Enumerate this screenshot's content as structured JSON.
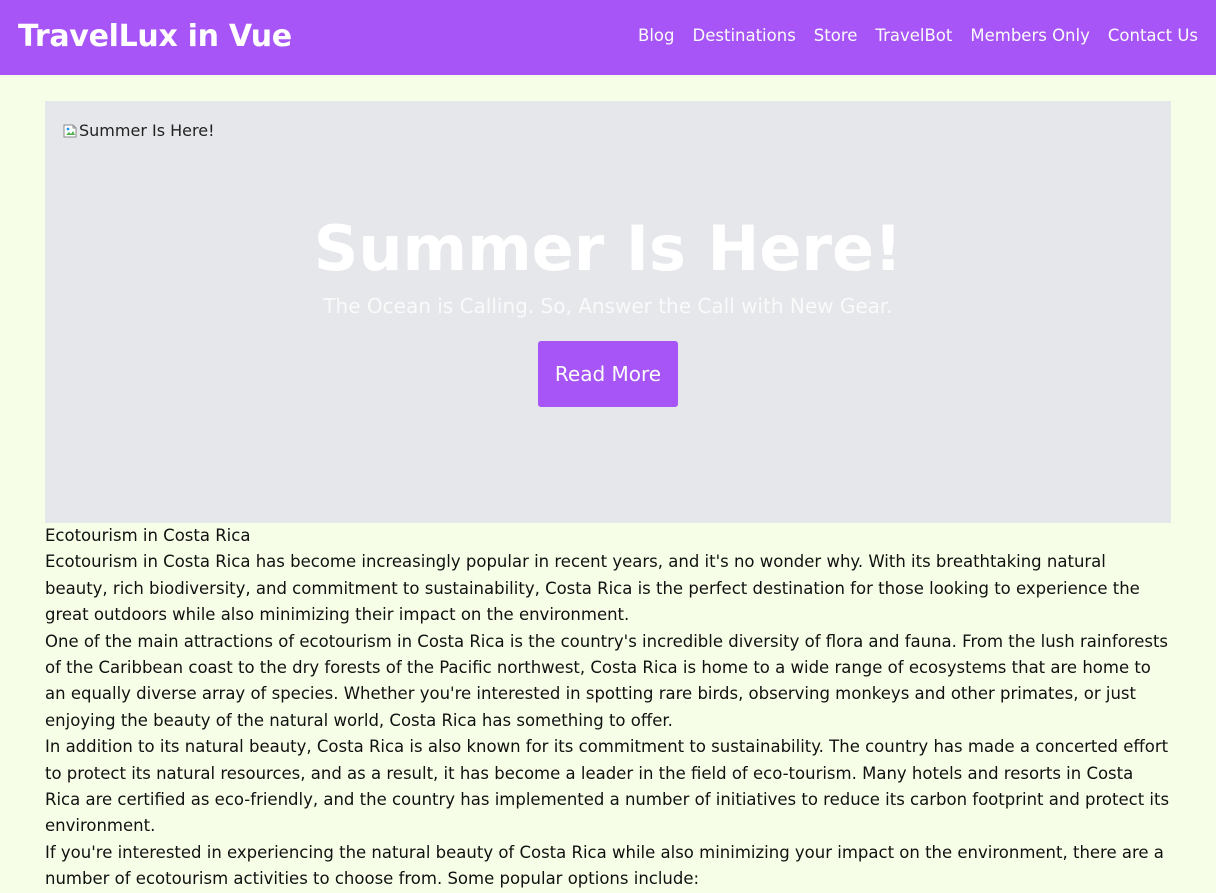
{
  "header": {
    "brand": "TravelLux in Vue",
    "nav": [
      "Blog",
      "Destinations",
      "Store",
      "TravelBot",
      "Members Only",
      "Contact Us"
    ]
  },
  "hero": {
    "image_alt": "Summer Is Here!",
    "title": "Summer Is Here!",
    "subtitle": "The Ocean is Calling. So, Answer the Call with New Gear.",
    "button": "Read More"
  },
  "article": {
    "heading": "Ecotourism in Costa Rica",
    "paragraphs": [
      "Ecotourism in Costa Rica has become increasingly popular in recent years, and it's no wonder why. With its breathtaking natural beauty, rich biodiversity, and commitment to sustainability, Costa Rica is the perfect destination for those looking to experience the great outdoors while also minimizing their impact on the environment.",
      "One of the main attractions of ecotourism in Costa Rica is the country's incredible diversity of flora and fauna. From the lush rainforests of the Caribbean coast to the dry forests of the Pacific northwest, Costa Rica is home to a wide range of ecosystems that are home to an equally diverse array of species. Whether you're interested in spotting rare birds, observing monkeys and other primates, or just enjoying the beauty of the natural world, Costa Rica has something to offer.",
      "In addition to its natural beauty, Costa Rica is also known for its commitment to sustainability. The country has made a concerted effort to protect its natural resources, and as a result, it has become a leader in the field of eco-tourism. Many hotels and resorts in Costa Rica are certified as eco-friendly, and the country has implemented a number of initiatives to reduce its carbon footprint and protect its environment.",
      "If you're interested in experiencing the natural beauty of Costa Rica while also minimizing your impact on the environment, there are a number of ecotourism activities to choose from. Some popular options include:"
    ]
  },
  "colors": {
    "accent": "#a855f7",
    "page_background": "#f7fee7",
    "hero_background": "#e5e7eb"
  },
  "icons": {
    "broken_image": "broken-image-icon"
  }
}
